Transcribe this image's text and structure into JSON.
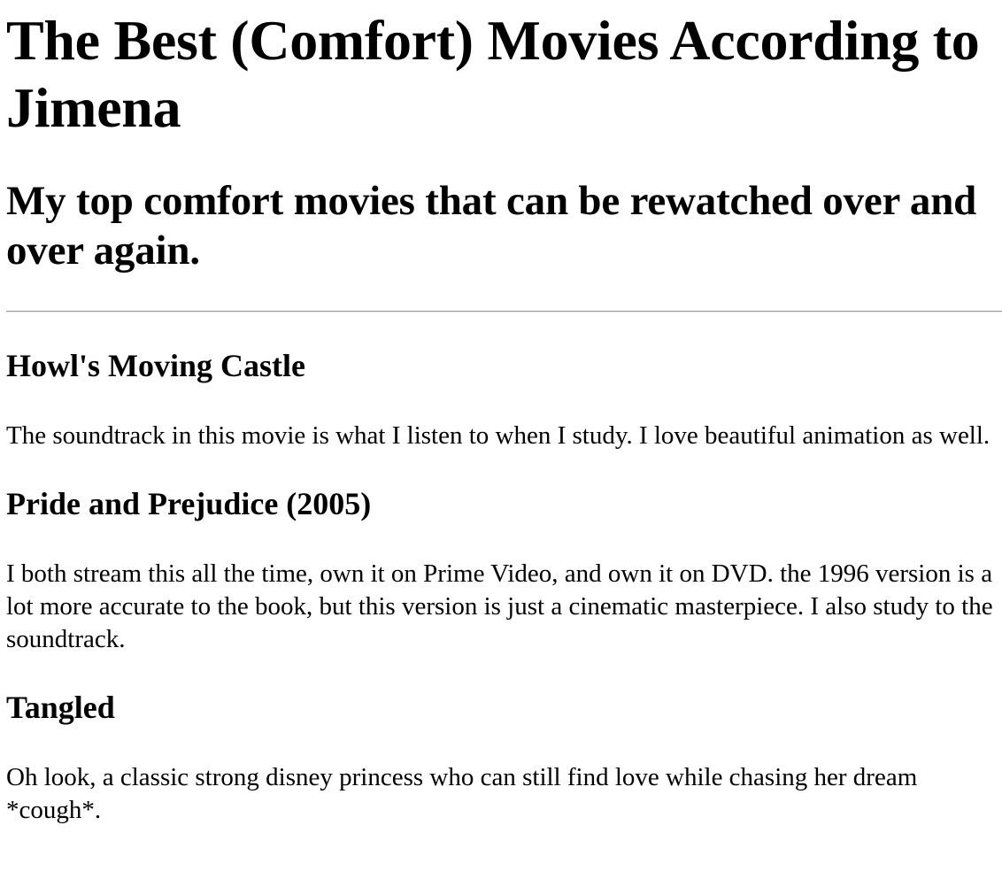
{
  "page": {
    "title": "The Best (Comfort) Movies According to Jimena",
    "subtitle": "My top comfort movies that can be rewatched over and over again."
  },
  "movies": [
    {
      "title": "Howl's Moving Castle",
      "description": "The soundtrack in this movie is what I listen to when I study. I love beautiful animation as well."
    },
    {
      "title": "Pride and Prejudice (2005)",
      "description": "I both stream this all the time, own it on Prime Video, and own it on DVD. the 1996 version is a lot more accurate to the book, but this version is just a cinematic masterpiece. I also study to the soundtrack."
    },
    {
      "title": "Tangled",
      "description": "Oh look, a classic strong disney princess who can still find love while chasing her dream *cough*."
    }
  ]
}
